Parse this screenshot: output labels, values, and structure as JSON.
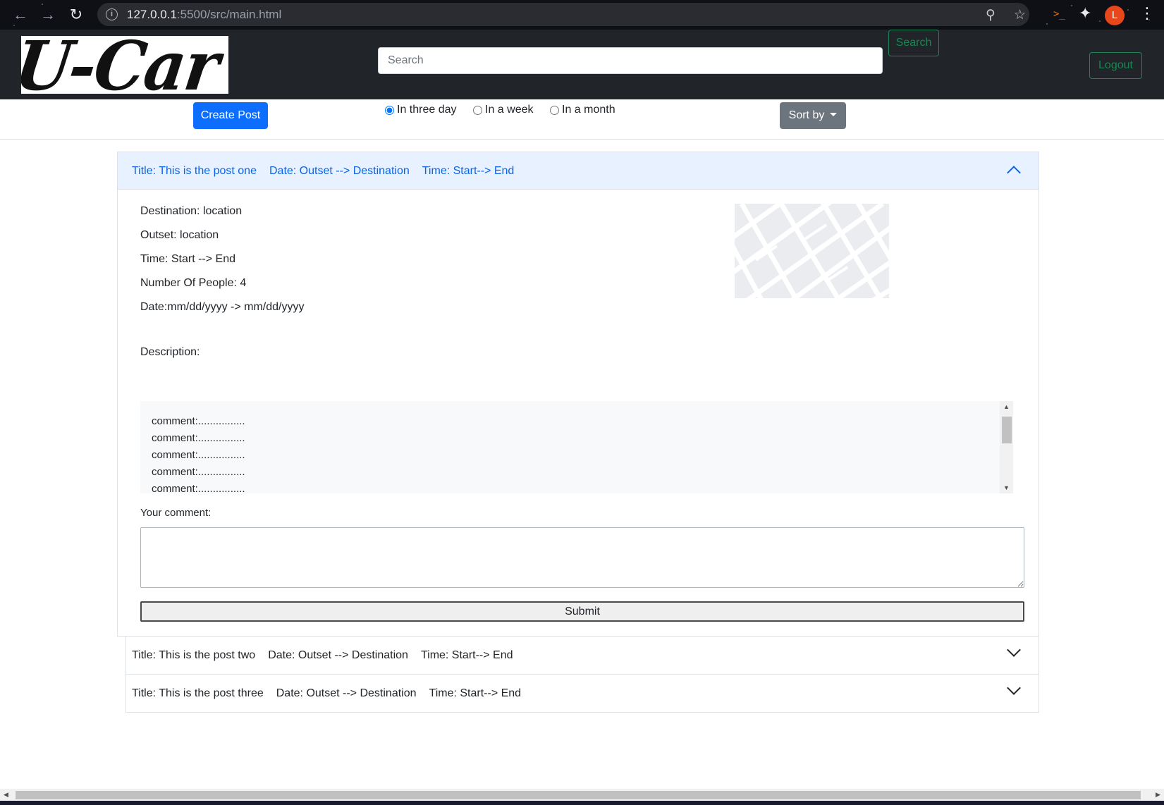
{
  "browser": {
    "url_host": "127.0.0.1",
    "url_path": ":5500/src/main.html",
    "back_icon": "back-arrow-icon",
    "forward_icon": "forward-arrow-icon",
    "reload_icon": "reload-icon",
    "avatar_initial": "L"
  },
  "navbar": {
    "logo_text": "U-Car",
    "search_placeholder": "Search",
    "search_button": "Search",
    "logout_button": "Logout"
  },
  "filters": {
    "create_post": "Create Post",
    "ranges": [
      {
        "label": "In three day",
        "checked": true
      },
      {
        "label": "In a week",
        "checked": false
      },
      {
        "label": "In a month",
        "checked": false
      }
    ],
    "sort_label": "Sort by"
  },
  "posts": [
    {
      "title": "Title: This is the post one",
      "date": "Date: Outset --> Destination",
      "time": "Time: Start--> End",
      "expanded": true
    },
    {
      "title": "Title: This is the post two",
      "date": "Date: Outset --> Destination",
      "time": "Time: Start--> End",
      "expanded": false
    },
    {
      "title": "Title: This is the post three",
      "date": "Date: Outset --> Destination",
      "time": "Time: Start--> End",
      "expanded": false
    }
  ],
  "post_detail": {
    "destination": "Destination: location",
    "outset": "Outset: location",
    "time": "Time: Start --> End",
    "people": "Number Of People: 4",
    "date": "Date:mm/dd/yyyy -> mm/dd/yyyy",
    "description": "Description:",
    "comments": [
      "comment:................",
      "comment:................",
      "comment:................",
      "comment:................",
      "comment:................"
    ],
    "your_comment_label": "Your comment:",
    "submit_label": "Submit"
  },
  "colors": {
    "navbar_bg": "#212529",
    "primary": "#0d6efd",
    "success": "#198754",
    "secondary": "#6c757d",
    "accordion_active_bg": "#e7f1ff",
    "accordion_active_text": "#0c63e4"
  }
}
